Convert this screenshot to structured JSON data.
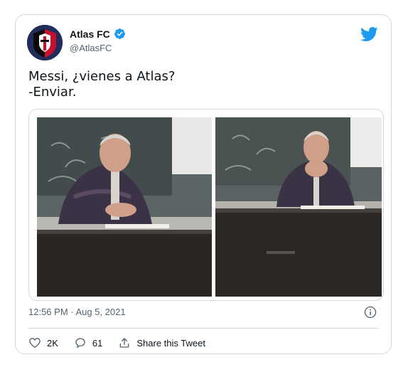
{
  "tweet": {
    "author_name": "Atlas FC",
    "author_handle": "@AtlasFC",
    "verified": true,
    "text": "Messi, ¿vienes a Atlas?\n-Enviar.",
    "timestamp": "12:56 PM · Aug 5, 2021",
    "likes": "2K",
    "replies": "61",
    "share_label": "Share this Tweet"
  },
  "colors": {
    "brand_blue": "#1d9bf0",
    "secondary_text": "#536471",
    "border": "#cfd9de",
    "avatar_red": "#c8102e",
    "avatar_navy": "#1f2c5c"
  },
  "icons": {
    "verified": "verified-badge-icon",
    "logo": "twitter-bird-icon",
    "info": "info-icon",
    "like": "heart-icon",
    "reply": "speech-bubble-icon",
    "share": "share-upload-icon"
  }
}
